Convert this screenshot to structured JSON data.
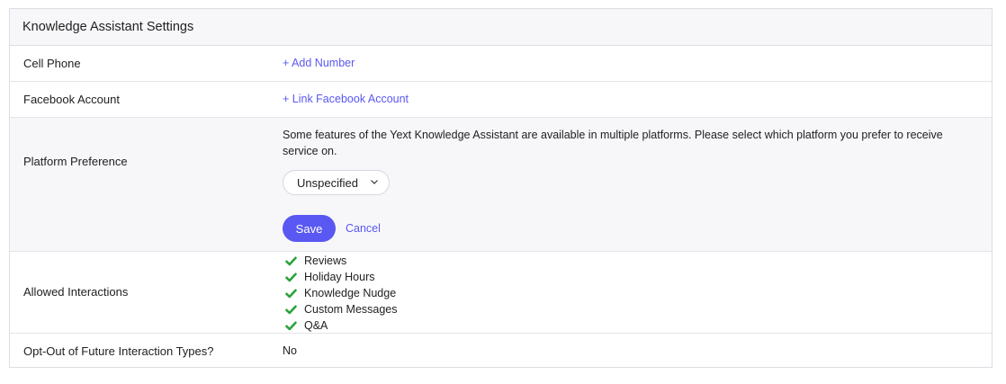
{
  "panel": {
    "title": "Knowledge Assistant Settings"
  },
  "rows": {
    "cell_phone": {
      "label": "Cell Phone",
      "action": "+ Add Number"
    },
    "facebook": {
      "label": "Facebook Account",
      "action": "+ Link Facebook Account"
    },
    "platform": {
      "label": "Platform Preference",
      "description": "Some features of the Yext Knowledge Assistant are available in multiple platforms. Please select which platform you prefer to receive service on.",
      "selected": "Unspecified",
      "save_label": "Save",
      "cancel_label": "Cancel"
    },
    "allowed": {
      "label": "Allowed Interactions",
      "items": [
        "Reviews",
        "Holiday Hours",
        "Knowledge Nudge",
        "Custom Messages",
        "Q&A"
      ]
    },
    "optout": {
      "label": "Opt-Out of Future Interaction Types?",
      "value": "No"
    }
  },
  "colors": {
    "accent": "#5a58f2",
    "check": "#2aa23a",
    "header_bg": "#f7f7fa"
  }
}
